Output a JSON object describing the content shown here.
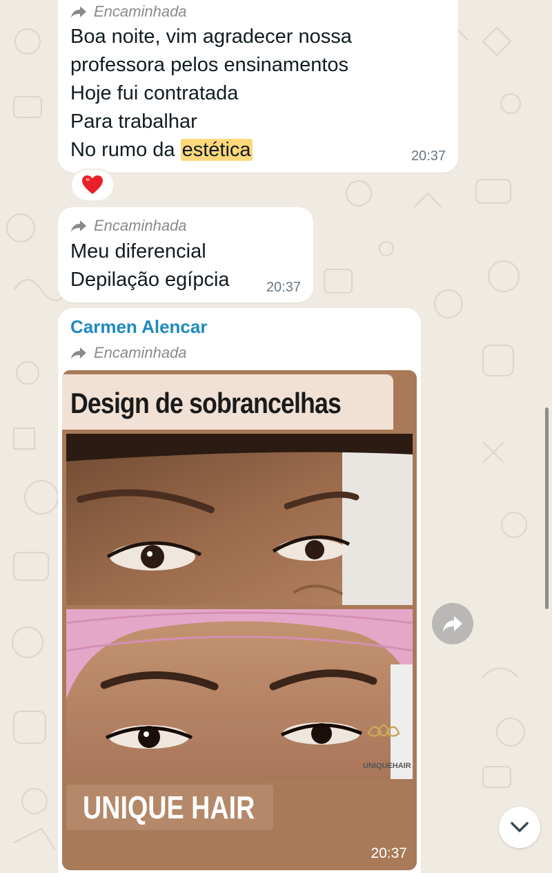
{
  "colors": {
    "chat_background": "#efeae2",
    "bubble": "#ffffff",
    "sender_name": "#1f8ac0",
    "highlight": "#ffd87a",
    "media_frame": "#a97a58"
  },
  "messages": [
    {
      "forwarded_label": "Encaminhada",
      "text_before_highlight": "Boa noite,  vim agradecer nossa\nprofessora pelos ensinamentos\nHoje fui contratada\nPara trabalhar\nNo rumo da ",
      "highlight": "estética",
      "time": "20:37",
      "reaction": "heart-emoji"
    },
    {
      "forwarded_label": "Encaminhada",
      "text": "Meu diferencial\nDepilação egípcia",
      "time": "20:37"
    },
    {
      "sender": "Carmen Alencar",
      "forwarded_label": "Encaminhada",
      "media": {
        "title": "Design de sobrancelhas",
        "brand": "UNIQUE HAIR",
        "photos": [
          "before-eyebrows-photo",
          "after-eyebrows-photo"
        ]
      },
      "time": "20:37"
    }
  ],
  "icons": {
    "forward": "forward-arrow-icon",
    "quick_forward": "forward-button-icon",
    "scroll_down": "chevron-down-icon",
    "location": "location-pin-icon"
  }
}
